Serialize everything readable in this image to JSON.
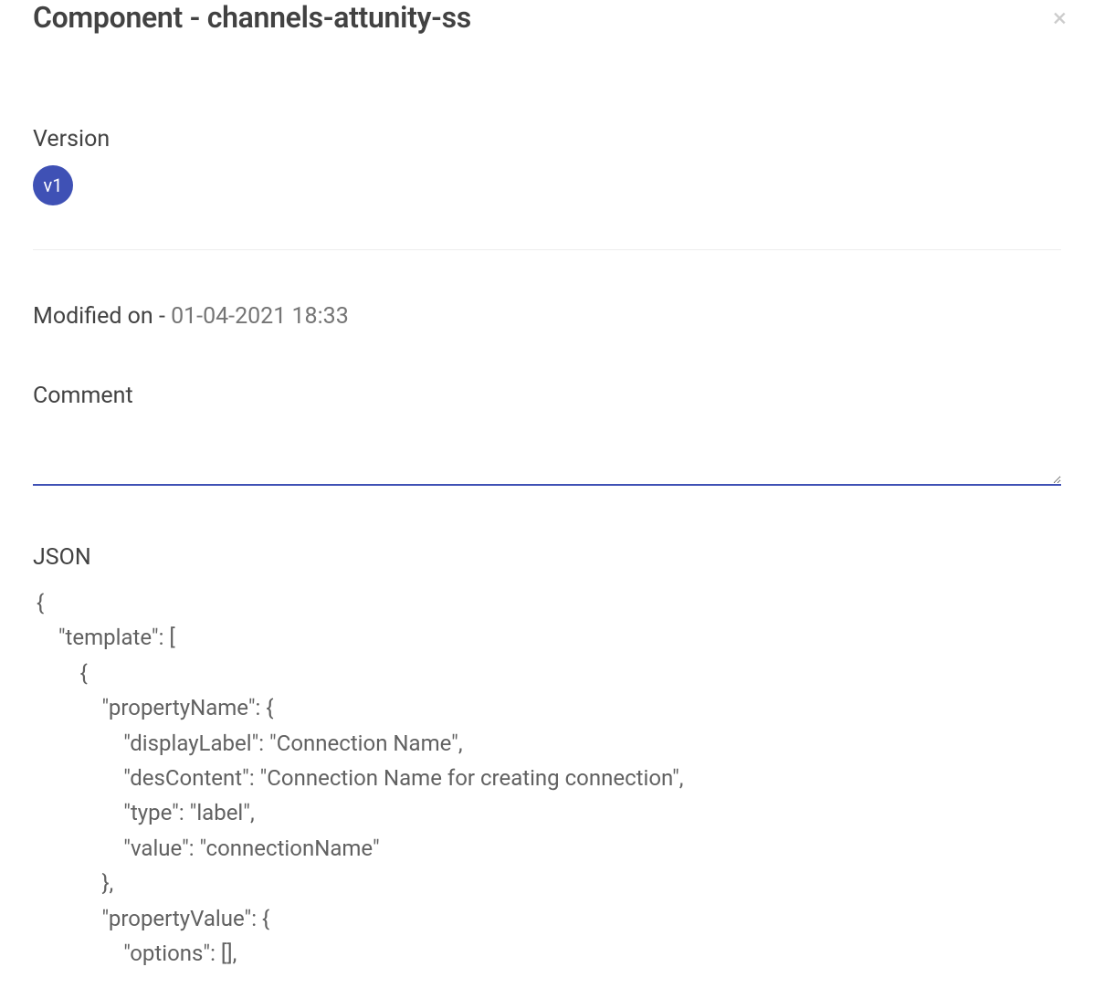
{
  "header": {
    "title": "Component - channels-attunity-ss"
  },
  "version": {
    "label": "Version",
    "badge": "v1"
  },
  "modified": {
    "label": "Modified on - ",
    "timestamp": "01-04-2021 18:33"
  },
  "comment": {
    "label": "Comment",
    "value": ""
  },
  "json": {
    "label": "JSON",
    "content": "{\n    \"template\": [\n        {\n            \"propertyName\": {\n                \"displayLabel\": \"Connection Name\",\n                \"desContent\": \"Connection Name for creating connection\",\n                \"type\": \"label\",\n                \"value\": \"connectionName\"\n            },\n            \"propertyValue\": {\n                \"options\": [],"
  }
}
